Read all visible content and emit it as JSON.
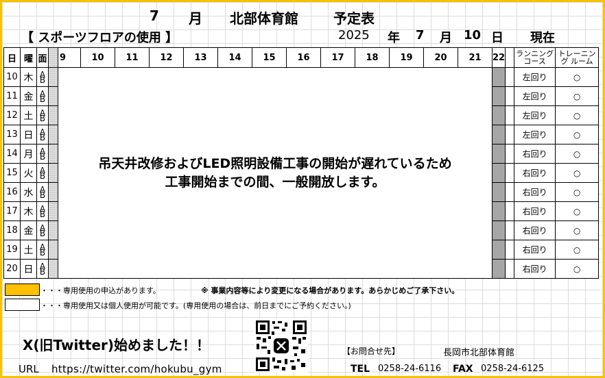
{
  "header": {
    "month": "7",
    "month_unit": "月",
    "facility": "北部体育館",
    "doc_title": "予定表",
    "section_label": "【 スポーツフロアの使用 】",
    "year": "2025",
    "year_unit": "年",
    "date_month": "7",
    "date_month_unit": "月",
    "date_day": "10",
    "date_day_unit": "日",
    "as_of": "現在"
  },
  "table": {
    "col_day": "日",
    "col_weekday": "曜",
    "col_side": "面",
    "hours": [
      "9",
      "10",
      "11",
      "12",
      "13",
      "14",
      "15",
      "16",
      "17",
      "18",
      "19",
      "20",
      "21",
      "22"
    ],
    "col_running": "ランニング コース",
    "col_training": "トレーニング ルーム",
    "ab_label": "A B",
    "message_line1": "吊天井改修およびLED照明設備工事の開始が遅れているため",
    "message_line2": "工事開始までの間、一般開放します。",
    "rows": [
      {
        "day": "10",
        "weekday": "木",
        "course": "左回り",
        "training": "○"
      },
      {
        "day": "11",
        "weekday": "金",
        "course": "左回り",
        "training": "○"
      },
      {
        "day": "12",
        "weekday": "土",
        "course": "左回り",
        "training": "○"
      },
      {
        "day": "13",
        "weekday": "日",
        "course": "左回り",
        "training": "○"
      },
      {
        "day": "14",
        "weekday": "月",
        "course": "右回り",
        "training": "○"
      },
      {
        "day": "15",
        "weekday": "火",
        "course": "右回り",
        "training": "○"
      },
      {
        "day": "16",
        "weekday": "水",
        "course": "右回り",
        "training": "○"
      },
      {
        "day": "17",
        "weekday": "木",
        "course": "右回り",
        "training": "○"
      },
      {
        "day": "18",
        "weekday": "金",
        "course": "右回り",
        "training": "○"
      },
      {
        "day": "19",
        "weekday": "土",
        "course": "右回り",
        "training": "○"
      },
      {
        "day": "20",
        "weekday": "日",
        "course": "右回り",
        "training": "○"
      }
    ]
  },
  "legend": {
    "reserved_text": "・・・専用使用の申込があります。",
    "notice": "※ 事業内容等により変更になる場合があります。あらかじめご了承下さい。",
    "open_text": "・・・専用使用又は個人使用が可能です。(専用使用の場合は、前日までにご予約ください。)",
    "reserved_color": "#ffc000"
  },
  "footer": {
    "x_announce": "X(旧Twitter)始めました！！",
    "url_label": "URL",
    "url": "https://twitter.com/hokubu_gym",
    "contact_label": "【お問合せ先】",
    "contact_name": "長岡市北部体育館",
    "tel_label": "TEL",
    "tel": "0258-24-6116",
    "fax_label": "FAX",
    "fax": "0258-24-6125"
  },
  "colors": {
    "border_accent": "#f5c400",
    "gray_column": "#a6a6a6",
    "legend_reserved": "#ffc000"
  }
}
